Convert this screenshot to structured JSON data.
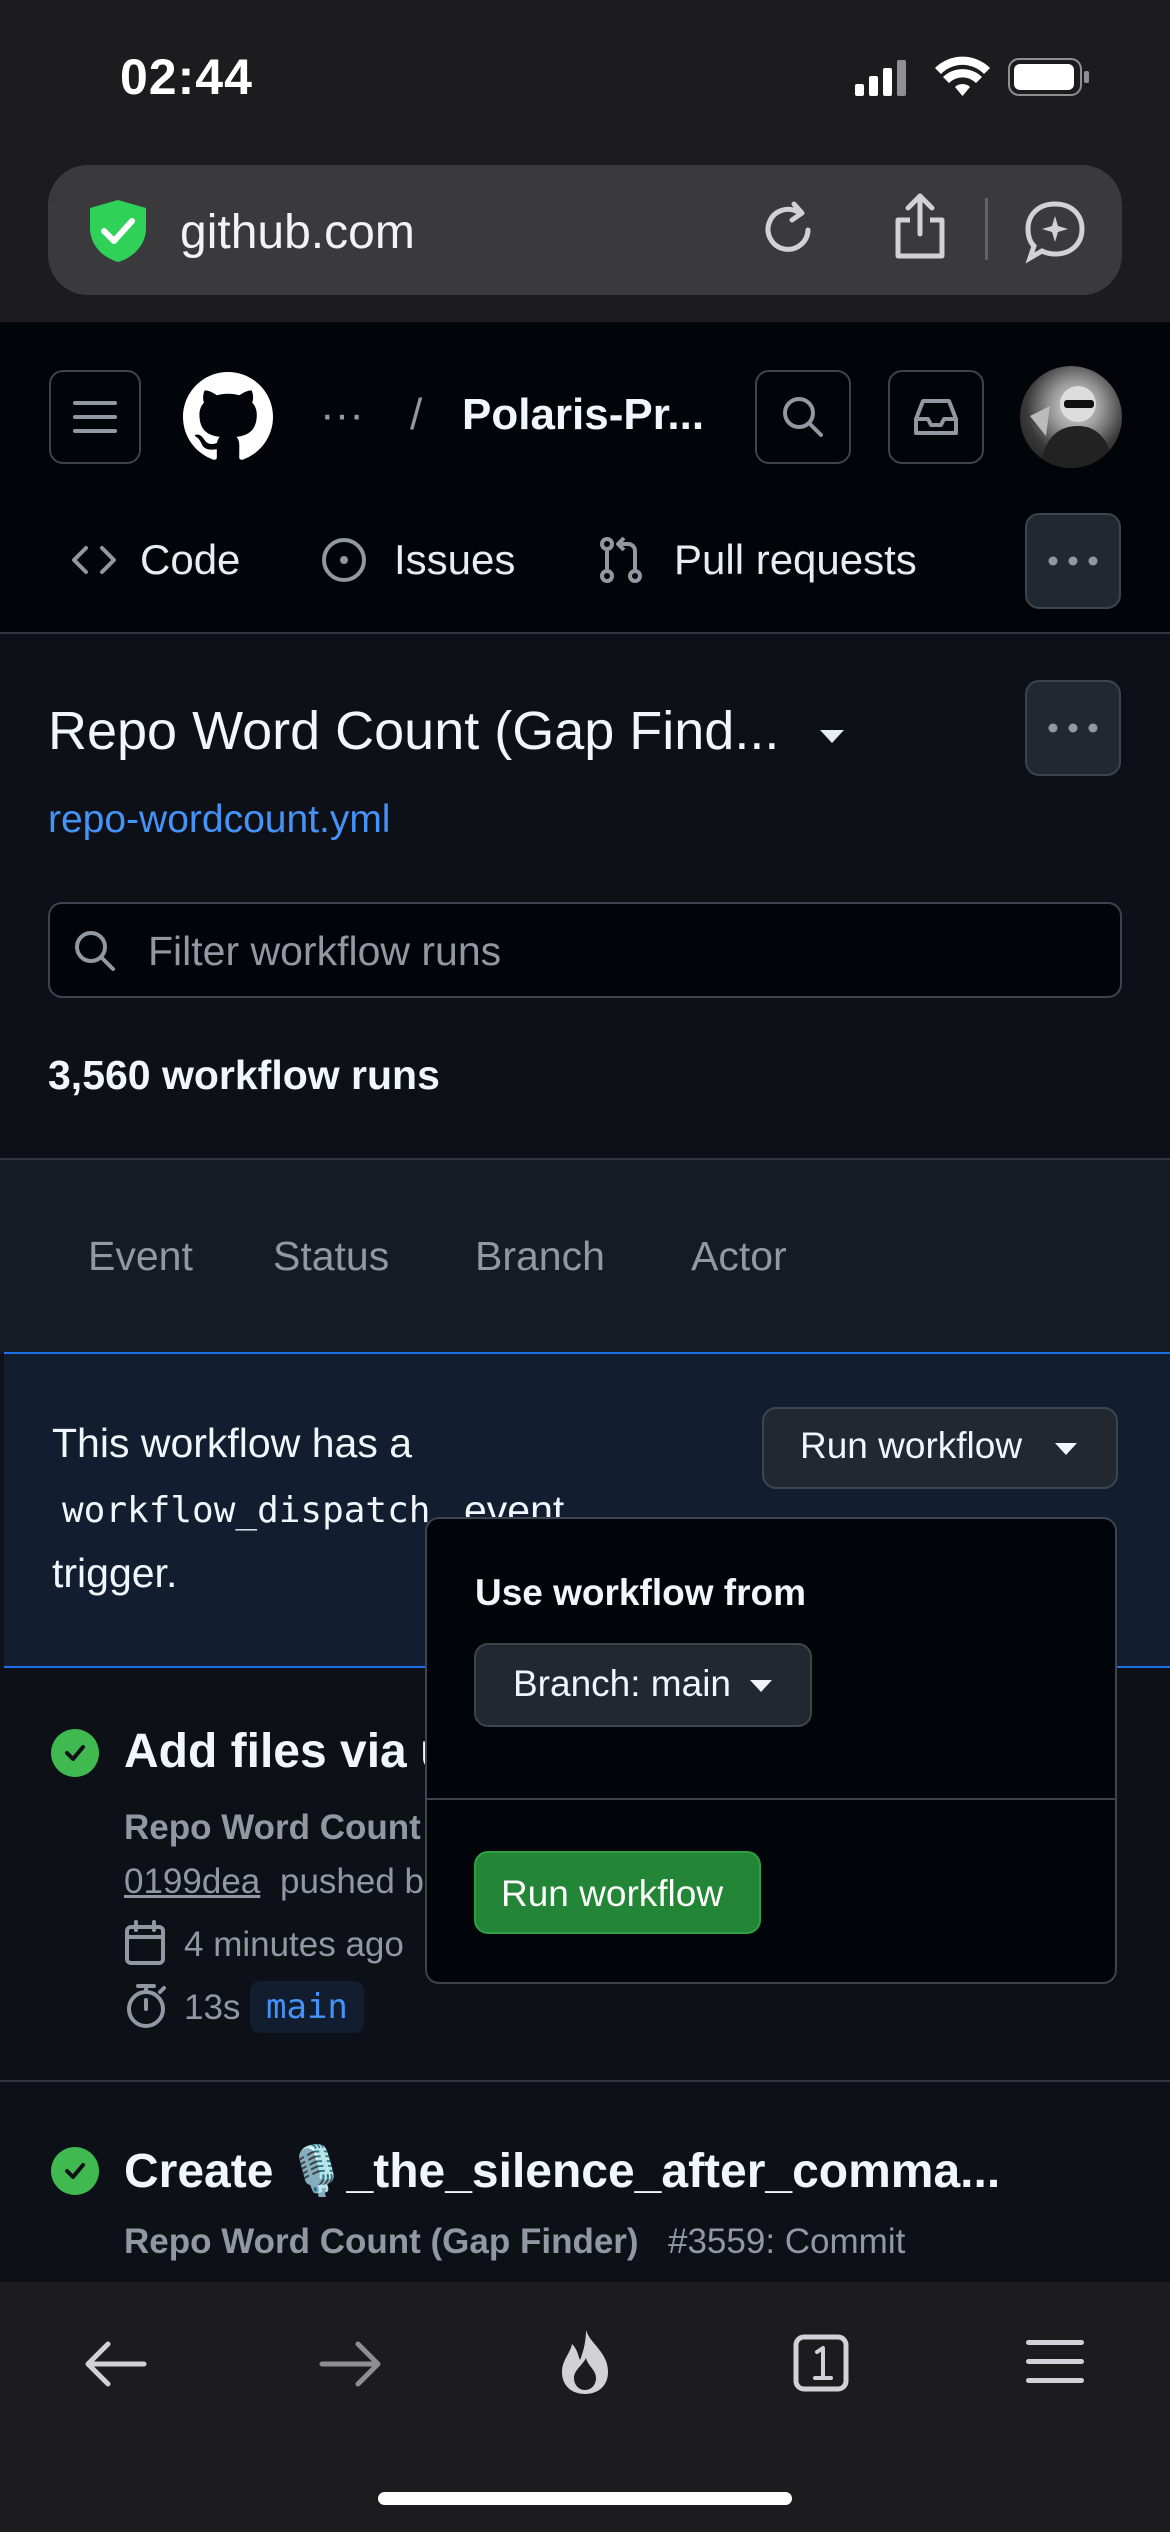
{
  "status_bar": {
    "time": "02:44"
  },
  "browser": {
    "url": "github.com"
  },
  "github": {
    "breadcrumb_more": "···",
    "breadcrumb_sep": "/",
    "repo_name": "Polaris-Pr...",
    "tabs": [
      {
        "label": "Code"
      },
      {
        "label": "Issues"
      },
      {
        "label": "Pull requests"
      }
    ],
    "workflow_title": "Repo Word Count (Gap Find...",
    "workflow_file": "repo-wordcount.yml",
    "filter_placeholder": "Filter workflow runs",
    "runs_count": "3,560 workflow runs",
    "filters": [
      "Event",
      "Status",
      "Branch",
      "Actor"
    ],
    "dispatch": {
      "line1": "This workflow has a",
      "code": "workflow_dispatch",
      "event_word": "event",
      "line3": "trigger.",
      "run_button": "Run workflow"
    },
    "popup": {
      "heading": "Use workflow from",
      "branch_select": "Branch: main",
      "run_button": "Run workflow"
    },
    "runs": [
      {
        "title": "Add files via u",
        "workflow": "Repo Word Count",
        "sha": "0199dea",
        "pushed": "pushed b",
        "time": "4 minutes ago",
        "duration": "13s",
        "branch": "main"
      },
      {
        "title": "Create 🎙️_the_silence_after_comma...",
        "workflow": "Repo Word Count (Gap Finder)",
        "detail": "#3559: Commit"
      }
    ]
  },
  "colors": {
    "accent": "#4493f8",
    "success": "#3fb950",
    "primary_btn": "#238636"
  }
}
